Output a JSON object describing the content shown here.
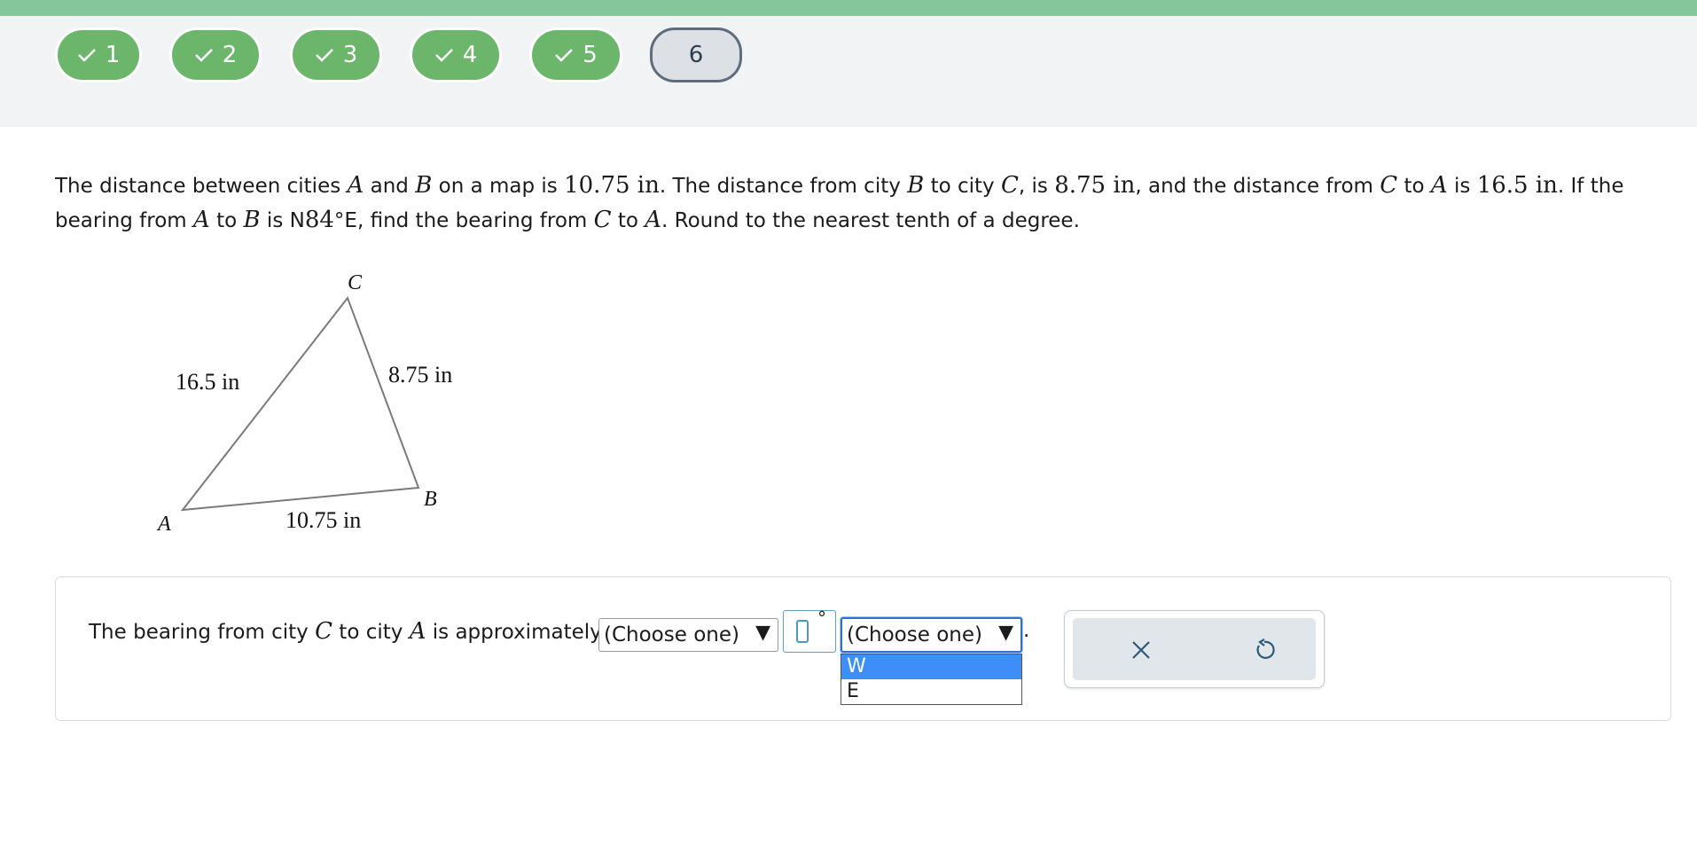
{
  "nav": {
    "questions": [
      {
        "label": "1",
        "status": "completed"
      },
      {
        "label": "2",
        "status": "completed"
      },
      {
        "label": "3",
        "status": "completed"
      },
      {
        "label": "4",
        "status": "completed"
      },
      {
        "label": "5",
        "status": "completed"
      },
      {
        "label": "6",
        "status": "current"
      }
    ]
  },
  "problem": {
    "t1": "The distance between cities ",
    "A": "A",
    "t2": " and ",
    "B": "B",
    "t3": " on a map is ",
    "d_ab": "10.75 in",
    "t4": ". The distance from city ",
    "t5": " to city ",
    "C": "C",
    "t6": ", is ",
    "d_bc": "8.75 in",
    "t7": ", and the distance from ",
    "t8": " to ",
    "t9": " is ",
    "d_ca": "16.5 in",
    "t10": ". If the bearing from ",
    "t11": " to ",
    "t12": " is N",
    "bearing_val": "84",
    "t13": "°E, find the bearing from ",
    "t14": " to ",
    "t15": ". Round to the nearest tenth of a degree."
  },
  "figure": {
    "vertex_a": "A",
    "vertex_b": "B",
    "vertex_c": "C",
    "side_ca": "16.5 in",
    "side_bc": "8.75 in",
    "side_ab": "10.75 in"
  },
  "answer": {
    "prefix": "The bearing from city ",
    "C": "C",
    "mid": " to city ",
    "A": "A",
    "suffix": " is approximately",
    "select1_value": "(Choose one)",
    "select2_value": "(Choose one)",
    "degree_sign": "°",
    "period": ".",
    "dropdown_options": [
      "W",
      "E"
    ]
  },
  "colors": {
    "completed": "#6bb66b",
    "top_strip": "#85c69a",
    "option_highlight": "#3d8ef8"
  },
  "icons": {
    "check": "check-icon",
    "clear": "close-icon",
    "undo": "undo-icon"
  }
}
